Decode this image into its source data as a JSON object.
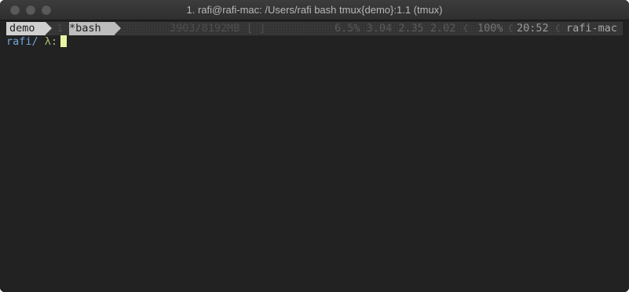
{
  "window": {
    "title": "1. rafi@rafi-mac: /Users/rafi bash tmux{demo}:1.1 (tmux)"
  },
  "tmux": {
    "session_name": "demo",
    "window_index": "1",
    "window_name": "*bash",
    "memory": "3903/8192MB",
    "memory_bar": "[          ]",
    "cpu_and_load": "6.5% 3.04 2.35 2.02",
    "separator": "❮",
    "battery": "100%",
    "time": "20:52",
    "hostname": "rafi-mac"
  },
  "terminal": {
    "prompt_path": "rafi/",
    "prompt_symbol": "λ:"
  },
  "colors": {
    "background": "#222222",
    "prompt_path": "#6fa8dc",
    "prompt_symbol": "#a6c36f",
    "cursor": "#e9f5a3"
  }
}
